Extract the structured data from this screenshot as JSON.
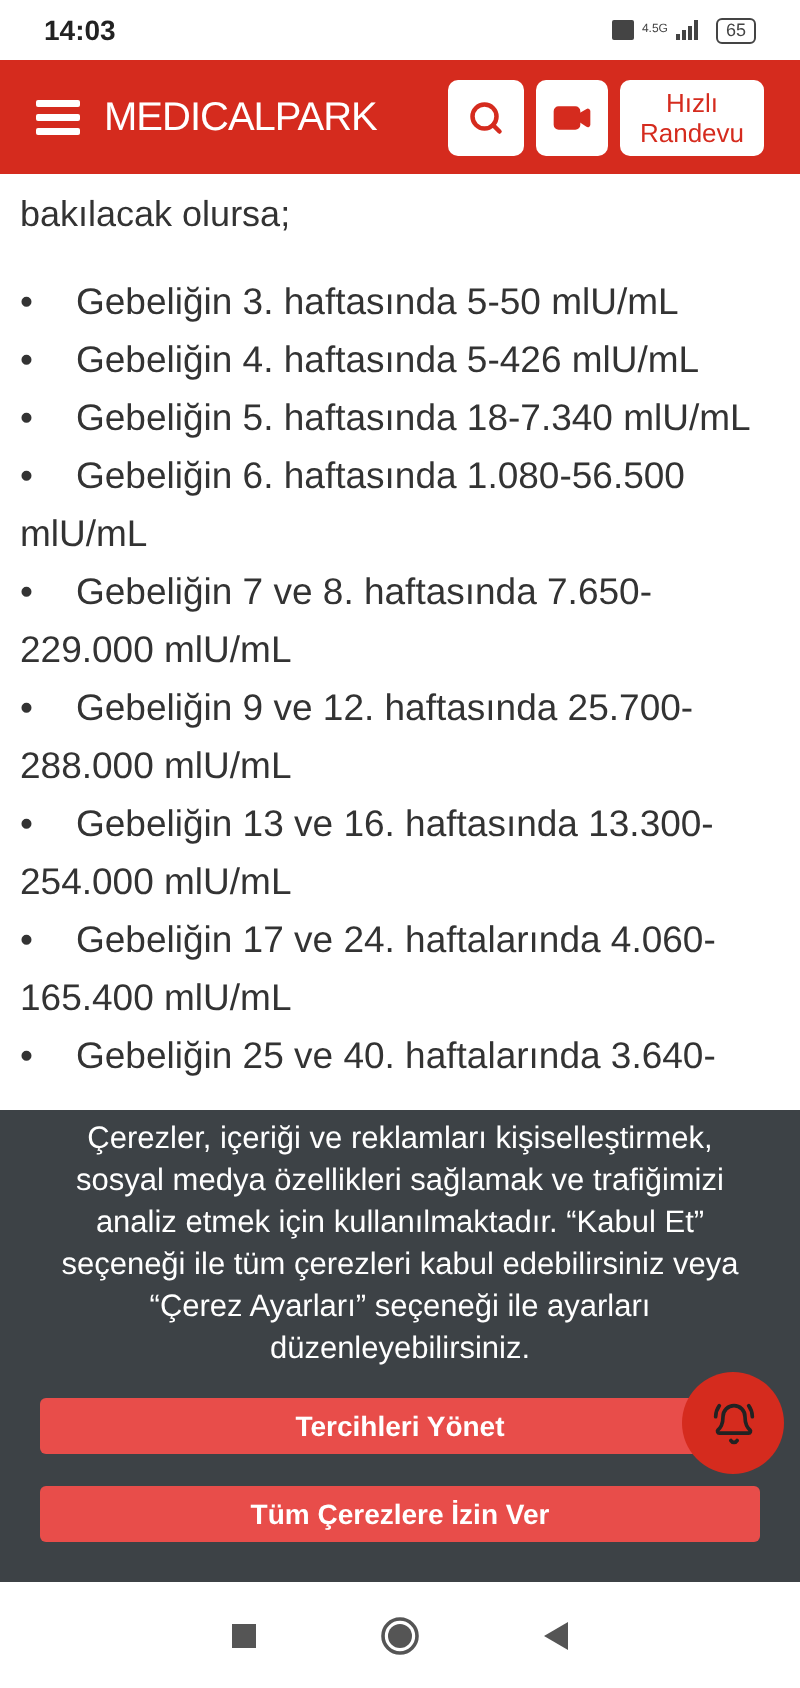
{
  "status_bar": {
    "time": "14:03",
    "network": "4.5G",
    "battery": "65"
  },
  "header": {
    "logo": "MEDICALPARK",
    "appointment_button": "Hızlı Randevu"
  },
  "article": {
    "intro": "bakılacak olursa;",
    "bullet_mark": "•",
    "bullets": [
      "Gebeliğin 3. haftasında 5-50 mlU/mL",
      "Gebeliğin 4. haftasında 5-426 mlU/mL",
      "Gebeliğin 5. haftasında 18-7.340 mlU/mL",
      "Gebeliğin 6. haftasında 1.080-56.500 mlU/mL",
      "Gebeliğin 7 ve 8. haftasında 7.650-229.000 mlU/mL",
      "Gebeliğin 9 ve 12. haftasında 25.700-288.000 mlU/mL",
      "Gebeliğin 13 ve 16. haftasında 13.300-254.000 mlU/mL",
      "Gebeliğin 17 ve 24. haftalarında 4.060-165.400 mlU/mL",
      "Gebeliğin 25 ve 40. haftalarında 3.640-"
    ]
  },
  "cookie_banner": {
    "message": "Çerezler, içeriği ve reklamları kişiselleştirmek, sosyal medya özellikleri sağlamak ve trafiğimizi analiz etmek için kullanılmaktadır. “Kabul Et” seçeneği ile tüm çerezleri kabul edebilirsiniz veya “Çerez Ayarları” seçeneği ile ayarları düzenleyebilirsiniz.",
    "buttons": [
      "Tercihleri Yönet",
      "Tüm Çerezlere İzin Ver"
    ]
  }
}
